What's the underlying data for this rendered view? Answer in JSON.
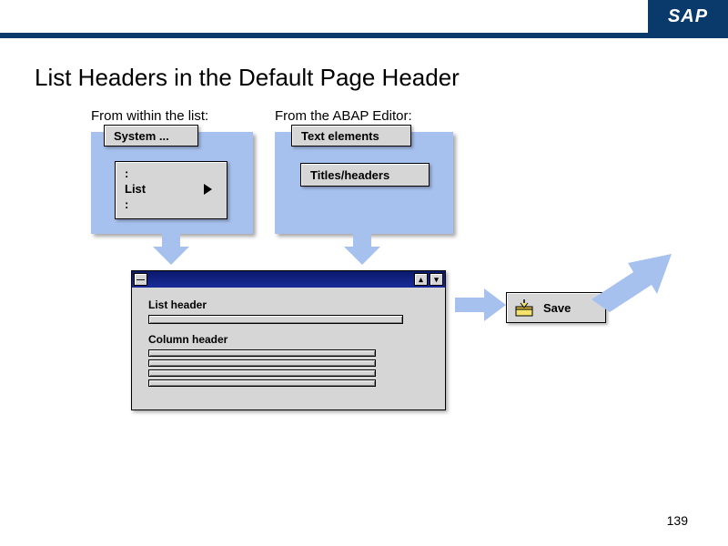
{
  "brand": "SAP",
  "slide_title": "List Headers in the Default Page Header",
  "captions": {
    "left": "From within the list:",
    "right": "From the ABAP Editor:"
  },
  "left_menu": {
    "system_label": "System  ...",
    "list_label": "List"
  },
  "right_menu": {
    "text_elements_label": "Text elements",
    "titles_headers_label": "Titles/headers"
  },
  "dialog": {
    "list_header_label": "List header",
    "column_header_label": "Column header",
    "titlebar": {
      "minimize": "—",
      "up": "▴",
      "close": "▾"
    }
  },
  "save_label": "Save",
  "page_number": "139"
}
